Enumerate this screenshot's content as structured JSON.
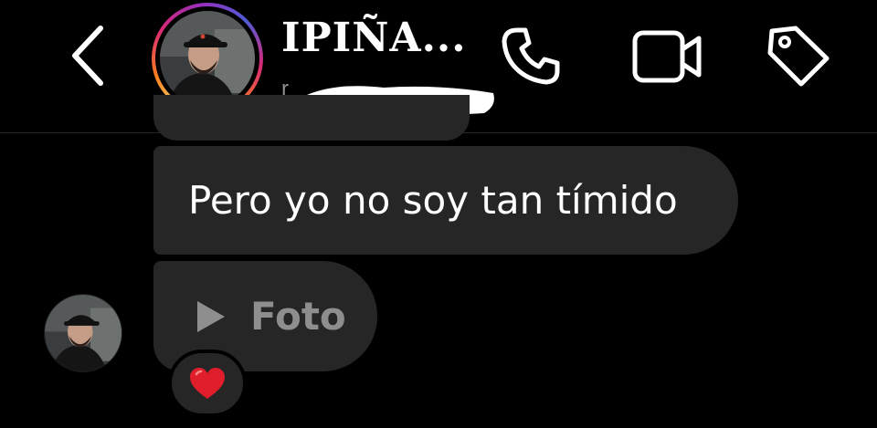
{
  "header": {
    "back_icon": "chevron-left-icon",
    "contact_name": "IPIÑA...",
    "contact_subtitle": "r",
    "subtitle_redacted": true,
    "actions": [
      {
        "name": "phone-icon"
      },
      {
        "name": "video-camera-icon"
      },
      {
        "name": "tag-icon"
      }
    ],
    "story_ring_colors": [
      "#feda75",
      "#fa7e1e",
      "#d62976",
      "#962fbf",
      "#4f5bd5"
    ]
  },
  "messages": [
    {
      "type": "text",
      "text": "Pero yo no soy tan tímido"
    },
    {
      "type": "media",
      "icon": "play-icon",
      "label": "Foto",
      "reaction": "❤️"
    }
  ],
  "colors": {
    "background": "#000000",
    "bubble": "#262626",
    "text": "#ffffff",
    "muted": "#8e8e8e",
    "heart": "#e01e2b"
  }
}
